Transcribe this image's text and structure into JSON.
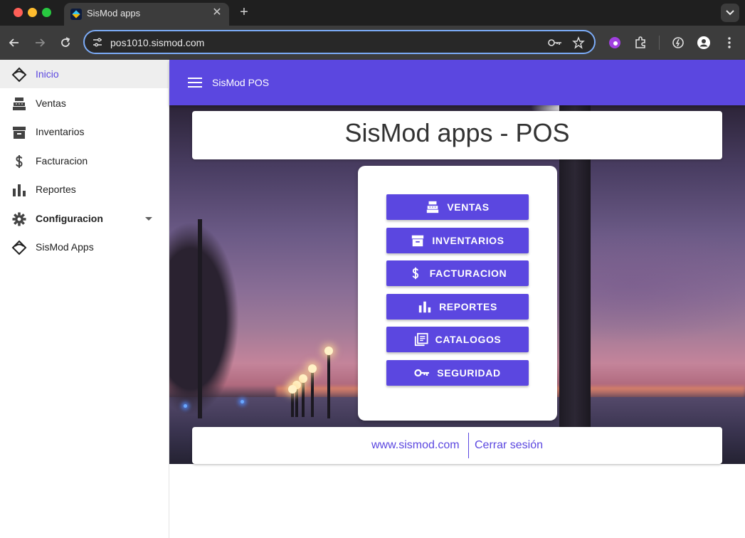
{
  "browser": {
    "tab_title": "SisMod apps",
    "url": "pos1010.sismod.com"
  },
  "sidebar": {
    "items": [
      {
        "label": "Inicio",
        "icon": "sismod-logo-icon",
        "active": true
      },
      {
        "label": "Ventas",
        "icon": "cash-register-icon"
      },
      {
        "label": "Inventarios",
        "icon": "archive-icon"
      },
      {
        "label": "Facturacion",
        "icon": "dollar-icon"
      },
      {
        "label": "Reportes",
        "icon": "bar-chart-icon"
      },
      {
        "label": "Configuracion",
        "icon": "gear-icon",
        "expandable": true
      },
      {
        "label": "SisMod Apps",
        "icon": "sismod-logo-icon"
      }
    ]
  },
  "appbar": {
    "title": "SisMod POS"
  },
  "main": {
    "heading": "SisMod apps - POS",
    "buttons": [
      {
        "label": "VENTAS",
        "icon": "cash-register-icon"
      },
      {
        "label": "INVENTARIOS",
        "icon": "archive-icon"
      },
      {
        "label": "FACTURACION",
        "icon": "dollar-icon"
      },
      {
        "label": "REPORTES",
        "icon": "bar-chart-icon"
      },
      {
        "label": "CATALOGOS",
        "icon": "library-books-icon"
      },
      {
        "label": "SEGURIDAD",
        "icon": "key-icon"
      }
    ]
  },
  "footer": {
    "website": "www.sismod.com",
    "logout": "Cerrar sesión"
  },
  "colors": {
    "primary": "#5b47e0",
    "browser_frame": "#1f1f1f",
    "toolbar": "#3c3c3c"
  }
}
